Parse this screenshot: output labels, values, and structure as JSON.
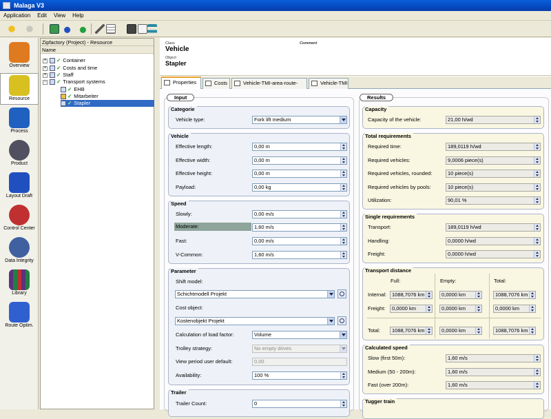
{
  "window": {
    "title": "Malaga V3"
  },
  "menu": [
    "Application",
    "Edit",
    "View",
    "Help"
  ],
  "toolbar_icons": [
    "back-icon",
    "forward-icon",
    "apply-icon",
    "undo-icon",
    "redo-icon",
    "edit-icon",
    "grid-icon",
    "save-icon",
    "page-icon",
    "exchange-icon"
  ],
  "sidebar": [
    {
      "label": "Overview",
      "icon": "overview-icon",
      "color": "#e07a20"
    },
    {
      "label": "Resource",
      "icon": "resource-icon",
      "color": "#d8c020",
      "selected": true
    },
    {
      "label": "Process",
      "icon": "process-icon",
      "color": "#2060c0"
    },
    {
      "label": "Product",
      "icon": "product-icon",
      "color": "#505060"
    },
    {
      "label": "Layout Draft",
      "icon": "layout-icon",
      "color": "#2050c0"
    },
    {
      "label": "Control Center",
      "icon": "control-icon",
      "color": "#c03030"
    },
    {
      "label": "Data Integrity",
      "icon": "data-icon",
      "color": "#4060a0"
    },
    {
      "label": "Library",
      "icon": "library-icon",
      "color": "#603080"
    },
    {
      "label": "Route Optim.",
      "icon": "route-icon",
      "color": "#3060d0"
    }
  ],
  "tree": {
    "header": "Zipfactory (Project) - Resource",
    "column": "Name",
    "nodes": [
      {
        "label": "Container",
        "level": 0,
        "exp": "+"
      },
      {
        "label": "Costs and time",
        "level": 0,
        "exp": "+"
      },
      {
        "label": "Staff",
        "level": 0,
        "exp": "+"
      },
      {
        "label": "Transport systems",
        "level": 0,
        "exp": "−"
      },
      {
        "label": "EHB",
        "level": 1
      },
      {
        "label": "Mitarbeiter",
        "level": 1
      },
      {
        "label": "Stapler",
        "level": 1,
        "selected": true
      }
    ]
  },
  "header": {
    "class_label": "Class",
    "class_value": "Vehicle",
    "comment_label": "Comment",
    "object_label": "Object",
    "object_value": "Stapler"
  },
  "tabs": [
    "Properties",
    "Costs",
    "Vehicle-TMI-area-route-pool",
    "Vehicle-TMI"
  ],
  "input": {
    "title": "Input",
    "categorie": {
      "title": "Categorie",
      "vehicle_type_label": "Vehicle type:",
      "vehicle_type": "Fork lift medium"
    },
    "vehicle": {
      "title": "Vehicle",
      "rows": [
        {
          "label": "Effective length:",
          "value": "0,00 m"
        },
        {
          "label": "Effective width:",
          "value": "0,00 m"
        },
        {
          "label": "Effective height:",
          "value": "0,00 m"
        },
        {
          "label": "Payload:",
          "value": "0,00 kg"
        }
      ]
    },
    "speed": {
      "title": "Speed",
      "rows": [
        {
          "label": "Slowly:",
          "value": "0,00 m/s"
        },
        {
          "label": "Moderate:",
          "value": "1,60 m/s"
        },
        {
          "label": "Fast:",
          "value": "0,00 m/s"
        },
        {
          "label": "V-Common:",
          "value": "1,60 m/s"
        }
      ]
    },
    "parameter": {
      "title": "Parameter",
      "shift_label": "Shift model:",
      "shift_value": "Schichtmodell Projekt",
      "cost_label": "Cost object:",
      "cost_value": "Kostenobjekt Projekt",
      "load_label": "Calculation of load factor:",
      "load_value": "Volume",
      "trolley_label": "Trolley strategy:",
      "trolley_value": "No empty drives",
      "period_label": "View period user default:",
      "period_value": "0,00",
      "avail_label": "Availability:",
      "avail_value": "100 %"
    },
    "trailer": {
      "title": "Trailer",
      "count_label": "Trailer Count:",
      "count_value": "0"
    }
  },
  "results": {
    "title": "Results",
    "capacity": {
      "title": "Capacity",
      "label": "Capacity of the vehicle:",
      "value": "21,00 h/wd"
    },
    "total": {
      "title": "Total requirements",
      "rows": [
        {
          "label": "Required time:",
          "value": "189,0119 h/wd"
        },
        {
          "label": "Required vehicles:",
          "value": "9,0006 piece(s)"
        },
        {
          "label": "Required vehicles, rounded:",
          "value": "10 piece(s)"
        },
        {
          "label": "Required vehicles by pools:",
          "value": "10 piece(s)"
        },
        {
          "label": "Utilization:",
          "value": "90,01 %"
        }
      ]
    },
    "single": {
      "title": "Single requirements",
      "rows": [
        {
          "label": "Transport:",
          "value": "189,0119 h/wd"
        },
        {
          "label": "Handling:",
          "value": "0,0000 h/wd"
        },
        {
          "label": "Freight:",
          "value": "0,0000 h/wd"
        }
      ]
    },
    "distance": {
      "title": "Transport distance",
      "col_full": "Full:",
      "col_empty": "Empty:",
      "col_total": "Total:",
      "rows": [
        {
          "label": "Internal:",
          "full": "1088,7076 km",
          "empty": "0,0000 km",
          "total": "1088,7076 km"
        },
        {
          "label": "Freight:",
          "full": "0,0000 km",
          "empty": "0,0000 km",
          "total": "0,0000 km"
        },
        {
          "label": "Total:",
          "full": "1088,7076 km",
          "empty": "0,0000 km",
          "total": "1088,7076 km"
        }
      ]
    },
    "calcspeed": {
      "title": "Calculated speed",
      "rows": [
        {
          "label": "Slow (first 50m):",
          "value": "1,60 m/s"
        },
        {
          "label": "Medium (50 - 200m):",
          "value": "1,60 m/s"
        },
        {
          "label": "Fast (over 200m):",
          "value": "1,60 m/s"
        }
      ]
    },
    "tugger": {
      "title": "Tugger train"
    }
  }
}
